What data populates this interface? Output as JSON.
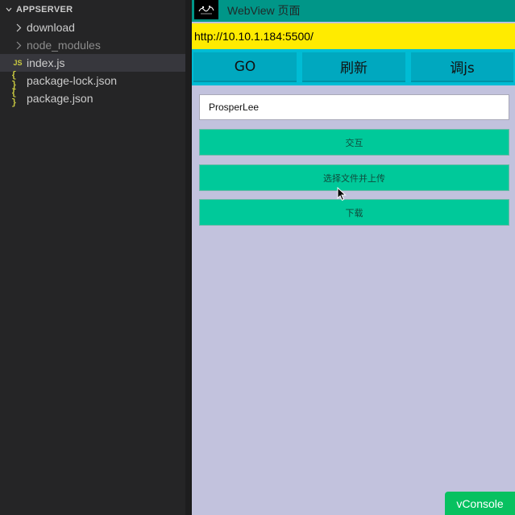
{
  "explorer": {
    "section_title": "APPSERVER",
    "items": [
      {
        "kind": "folder",
        "label": "download",
        "dim": false
      },
      {
        "kind": "folder",
        "label": "node_modules",
        "dim": true
      },
      {
        "kind": "file",
        "icon": "JS",
        "label": "index.js",
        "selected": true
      },
      {
        "kind": "file",
        "icon": "{ }",
        "label": "package-lock.json"
      },
      {
        "kind": "file",
        "icon": "{ }",
        "label": "package.json"
      }
    ]
  },
  "webview": {
    "app_title": "WebView 页面",
    "url": "http://10.10.1.184:5500/",
    "nav_buttons": [
      "GO",
      "刷新",
      "调js"
    ],
    "input_value": "ProsperLee",
    "actions": [
      "交互",
      "选择文件并上传",
      "下载"
    ],
    "vconsole_label": "vConsole"
  },
  "colors": {
    "appbar": "#009688",
    "url_bar": "#ffeb00",
    "button_row": "#00bcd4",
    "action_button": "#00c99a",
    "page_background": "#c2c2dd",
    "vconsole": "#07c160"
  }
}
